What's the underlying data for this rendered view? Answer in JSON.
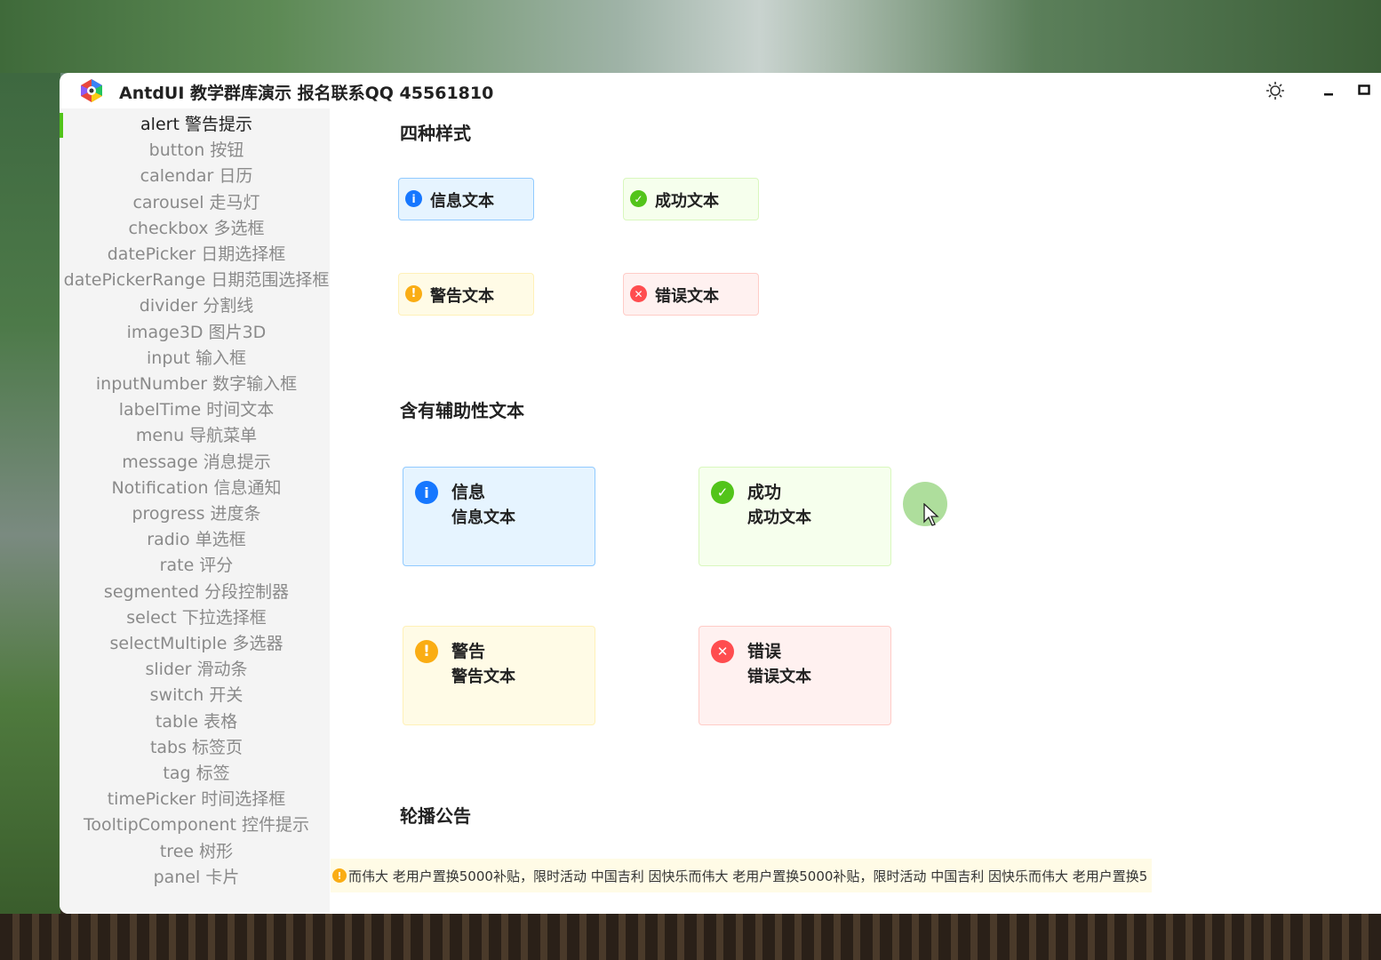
{
  "window": {
    "title": "AntdUI 教学群库演示 报名联系QQ 45561810",
    "controls": {
      "theme": "☀",
      "minimize": "–",
      "maximize": "□"
    }
  },
  "sidebar": {
    "items": [
      {
        "label": "alert 警告提示",
        "active": true
      },
      {
        "label": "button 按钮"
      },
      {
        "label": "calendar 日历"
      },
      {
        "label": "carousel 走马灯"
      },
      {
        "label": "checkbox 多选框"
      },
      {
        "label": "datePicker 日期选择框"
      },
      {
        "label": "datePickerRange 日期范围选择框"
      },
      {
        "label": "divider 分割线"
      },
      {
        "label": "image3D 图片3D"
      },
      {
        "label": "input 输入框"
      },
      {
        "label": "inputNumber 数字输入框"
      },
      {
        "label": "labelTime 时间文本"
      },
      {
        "label": "menu 导航菜单"
      },
      {
        "label": "message 消息提示"
      },
      {
        "label": "Notification 信息通知"
      },
      {
        "label": "progress 进度条"
      },
      {
        "label": "radio 单选框"
      },
      {
        "label": "rate 评分"
      },
      {
        "label": "segmented 分段控制器"
      },
      {
        "label": "select 下拉选择框"
      },
      {
        "label": "selectMultiple 多选器"
      },
      {
        "label": "slider 滑动条"
      },
      {
        "label": "switch 开关"
      },
      {
        "label": "table 表格"
      },
      {
        "label": "tabs 标签页"
      },
      {
        "label": "tag  标签"
      },
      {
        "label": "timePicker 时间选择框"
      },
      {
        "label": "TooltipComponent 控件提示"
      },
      {
        "label": "tree 树形"
      },
      {
        "label": "panel 卡片"
      }
    ]
  },
  "main": {
    "section1": {
      "title": "四种样式",
      "alerts": {
        "info": "信息文本",
        "success": "成功文本",
        "warning": "警告文本",
        "error": "错误文本"
      }
    },
    "section2": {
      "title": "含有辅助性文本",
      "alerts": {
        "info": {
          "title": "信息",
          "desc": "信息文本"
        },
        "success": {
          "title": "成功",
          "desc": "成功文本"
        },
        "warning": {
          "title": "警告",
          "desc": "警告文本"
        },
        "error": {
          "title": "错误",
          "desc": "错误文本"
        }
      }
    },
    "section3": {
      "title": "轮播公告",
      "marquee_text": "而伟大  老用户置换5000补贴，限时活动    中国吉利  因快乐而伟大  老用户置换5000补贴，限时活动    中国吉利  因快乐而伟大  老用户置换5"
    }
  },
  "colors": {
    "info": "#1677ff",
    "success": "#52c41a",
    "warning": "#faad14",
    "error": "#ff4d4f",
    "active_indicator": "#52c41a"
  },
  "icons": {
    "info": "info-circle-icon",
    "success": "check-circle-icon",
    "warning": "exclamation-circle-icon",
    "error": "close-circle-icon"
  }
}
